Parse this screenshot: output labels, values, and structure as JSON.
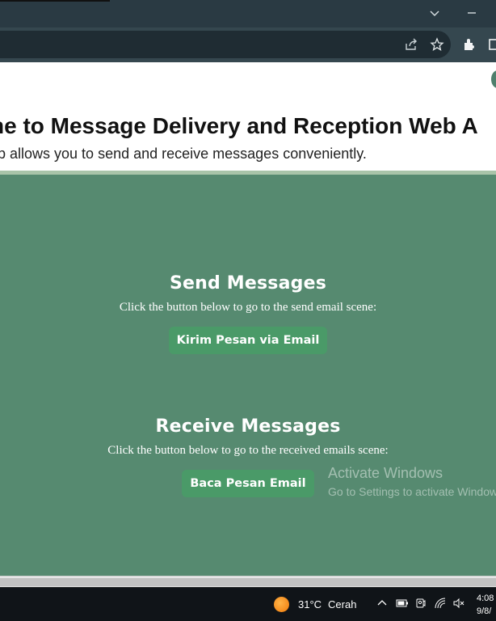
{
  "browser": {
    "icons": [
      "chevron-down-icon",
      "minimize-icon",
      "share-icon",
      "star-icon",
      "extensions-icon",
      "side-panel-icon"
    ]
  },
  "header": {
    "title": "ne to Message Delivery and Reception Web A",
    "subtitle": "p allows you to send and receive messages conveniently."
  },
  "send": {
    "heading": "Send Messages",
    "description": "Click the button below to go to the send email scene:",
    "button_label": "Kirim Pesan via Email"
  },
  "receive": {
    "heading": "Receive Messages",
    "description": "Click the button below to go to the received emails scene:",
    "button_label": "Baca Pesan Email"
  },
  "watermark": {
    "line1": "Activate Windows",
    "line2": "Go to Settings to activate Windows."
  },
  "taskbar": {
    "temperature": "31°C",
    "weather": "Cerah",
    "time": "4:08",
    "date": "9/8/"
  },
  "colors": {
    "main_bg": "#568a70",
    "button_bg": "#4a9a68",
    "header_border": "#a9c4a9"
  }
}
